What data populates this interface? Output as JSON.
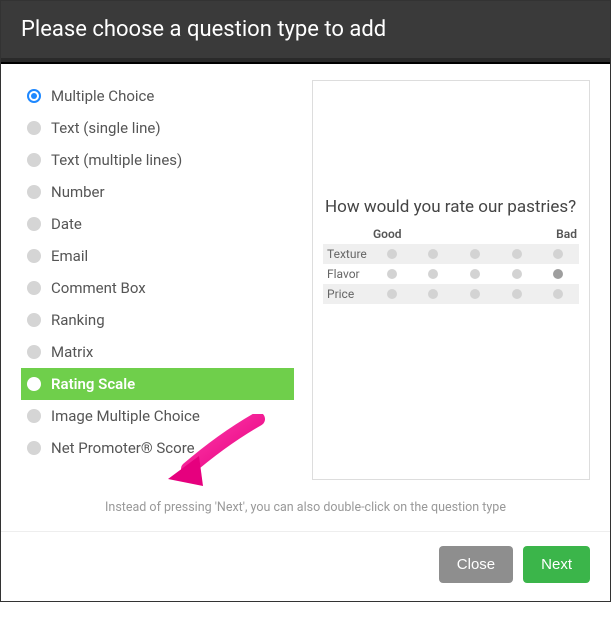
{
  "header": {
    "title": "Please choose a question type to add"
  },
  "types": [
    {
      "key": "multiple-choice",
      "label": "Multiple Choice",
      "selected": true
    },
    {
      "key": "text-single",
      "label": "Text (single line)"
    },
    {
      "key": "text-multi",
      "label": "Text (multiple lines)"
    },
    {
      "key": "number",
      "label": "Number"
    },
    {
      "key": "date",
      "label": "Date"
    },
    {
      "key": "email",
      "label": "Email"
    },
    {
      "key": "comment-box",
      "label": "Comment Box"
    },
    {
      "key": "ranking",
      "label": "Ranking"
    },
    {
      "key": "matrix",
      "label": "Matrix"
    },
    {
      "key": "rating-scale",
      "label": "Rating Scale",
      "highlight": true
    },
    {
      "key": "image-mc",
      "label": "Image Multiple Choice"
    },
    {
      "key": "nps",
      "label": "Net Promoter® Score"
    }
  ],
  "preview": {
    "title": "How would you rate our pastries?",
    "scale_left": "Good",
    "scale_right": "Bad",
    "rows": [
      "Texture",
      "Flavor",
      "Price"
    ]
  },
  "hint": "Instead of pressing 'Next', you can also double-click on the question type",
  "footer": {
    "close": "Close",
    "next": "Next"
  }
}
